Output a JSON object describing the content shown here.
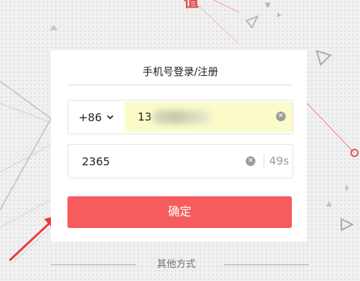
{
  "top_logo": "值",
  "card": {
    "title": "手机号登录/注册"
  },
  "phone": {
    "country_code": "+86",
    "value": "13",
    "masked": true
  },
  "code": {
    "value": "2365",
    "countdown": "49s"
  },
  "confirm_label": "确定",
  "other_methods": "其他方式",
  "colors": {
    "accent": "#f65b5d",
    "autofill": "#fafbc8",
    "arrow": "#e8383a"
  }
}
